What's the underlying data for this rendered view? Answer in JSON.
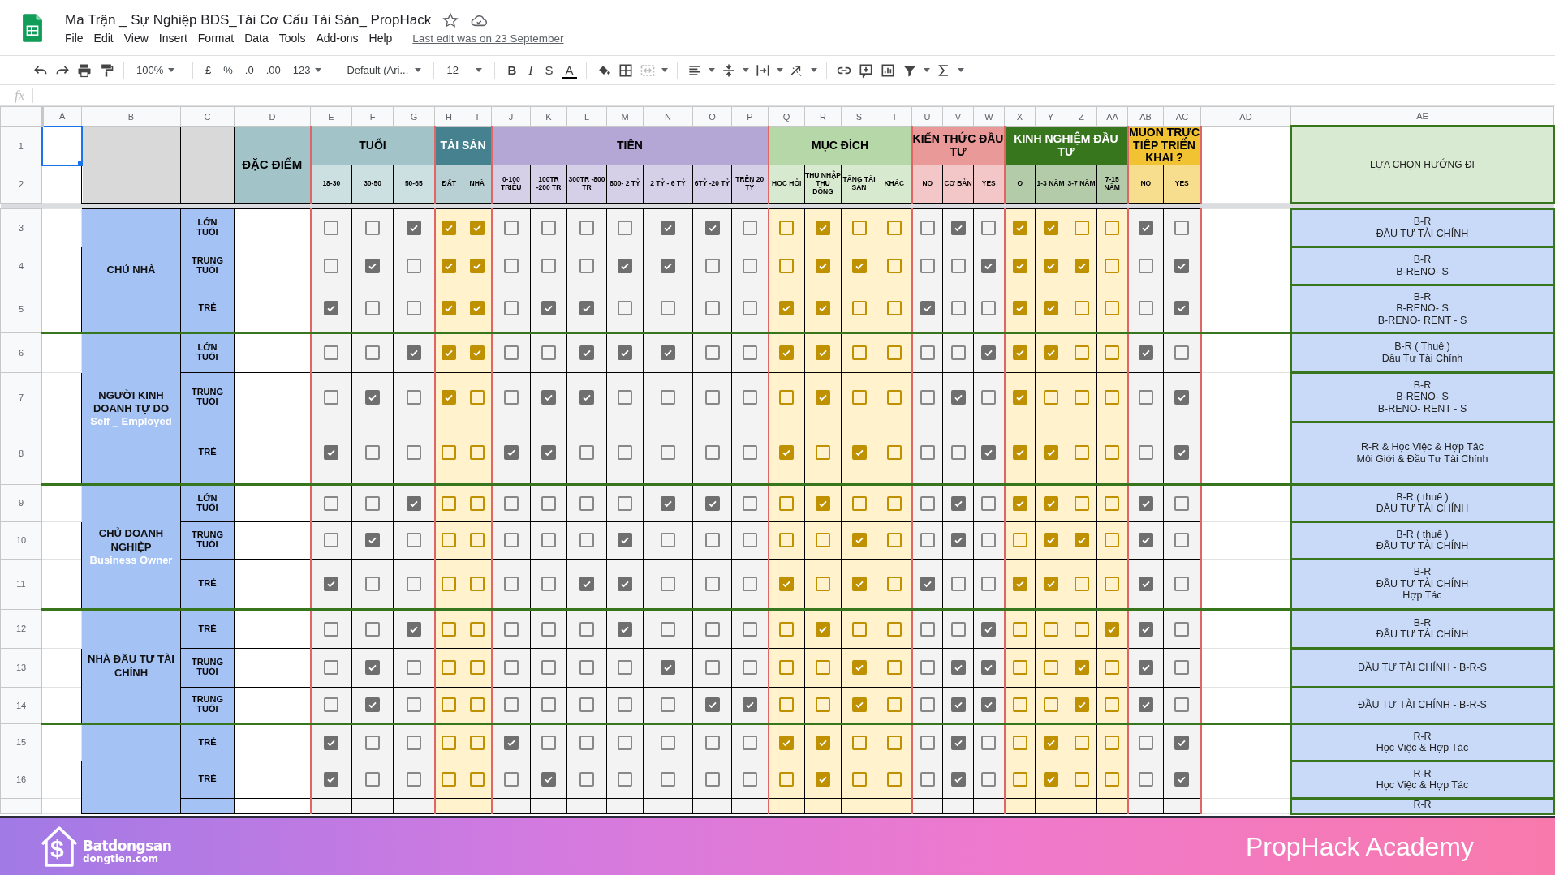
{
  "document": {
    "title": "Ma Trận _ Sự Nghiệp BDS_Tái Cơ Cấu Tài Sản_ PropHack",
    "menu": [
      "File",
      "Edit",
      "View",
      "Insert",
      "Format",
      "Data",
      "Tools",
      "Add-ons",
      "Help"
    ],
    "last_edit": "Last edit was on 23 September"
  },
  "toolbar": {
    "zoom": "100%",
    "currency": "£",
    "percent": "%",
    "decimal_less": ".0",
    "decimal_more": ".00",
    "number_format": "123",
    "font": "Default (Ari...",
    "font_size": "12",
    "bold": "B",
    "italic": "I",
    "strike": "S",
    "text_color": "A"
  },
  "formula_bar": {
    "label": "fx"
  },
  "sheet": {
    "columns": [
      "A",
      "B",
      "C",
      "D",
      "E",
      "F",
      "G",
      "H",
      "I",
      "J",
      "K",
      "L",
      "M",
      "N",
      "O",
      "P",
      "Q",
      "R",
      "S",
      "T",
      "U",
      "V",
      "W",
      "X",
      "Y",
      "Z",
      "AA",
      "AB",
      "AC",
      "AD",
      "AE"
    ],
    "header_rows": [
      {
        "number": "1",
        "selected": true
      },
      {
        "number": "2",
        "selected": false
      }
    ],
    "trait_header": "ĐẶC ĐIỂM",
    "result_header": "LỰA CHỌN HƯỚNG ĐI",
    "groups": [
      {
        "label": "TUỔI",
        "color": "#a2c4c9",
        "kind": "plain",
        "options": [
          "18-30",
          "30-50",
          "50-65"
        ]
      },
      {
        "label": "TÀI SẢN",
        "color": "#45818e",
        "kind": "gold",
        "options": [
          "ĐẤT",
          "NHÀ"
        ]
      },
      {
        "label": "TIỀN",
        "color": "#b4a7d6",
        "kind": "plain",
        "options": [
          "0-100 TRIỆU",
          "100TR -200 TR",
          "300TR -800 TR",
          "800- 2 TỶ",
          "2 TỶ - 6 TỶ",
          "6TỶ -20 TỶ",
          "TRÊN 20 TỶ"
        ]
      },
      {
        "label": "MỤC ĐÍCH",
        "color": "#b6d7a8",
        "kind": "gold",
        "options": [
          "HỌC HỎI",
          "THU NHẬP THỤ ĐỘNG",
          "TĂNG TÀI SẢN",
          "KHÁC"
        ]
      },
      {
        "label": "KIẾN THỨC ĐẦU TƯ",
        "color": "#ea9999",
        "kind": "plain",
        "options": [
          "NO",
          "CƠ BẢN",
          "YES"
        ]
      },
      {
        "label": "KINH NGHIỆM ĐẦU TƯ",
        "color": "#38761d",
        "kind": "gold",
        "options": [
          "O",
          "1-3 NĂM",
          "3-7 NĂM",
          "7-15 NĂM"
        ]
      },
      {
        "label": "MUỐN TRỰC TIẾP TRIỂN KHAI ?",
        "color": "#f1c232",
        "kind": "plain",
        "options": [
          "NO",
          "YES"
        ]
      }
    ],
    "segments": [
      {
        "label": "CHỦ NHÀ",
        "rows": [
          {
            "number": "3",
            "age": "LỚN TUỔI",
            "outcome": "B-R\nĐẦU TƯ TÀI CHÍNH",
            "checks": [
              false,
              false,
              true,
              true,
              true,
              false,
              false,
              false,
              false,
              true,
              true,
              false,
              false,
              true,
              false,
              false,
              false,
              true,
              false,
              true,
              true,
              false,
              false,
              true,
              false
            ]
          },
          {
            "number": "4",
            "age": "TRUNG TUỔI",
            "outcome": "B-R\nB-RENO- S",
            "checks": [
              false,
              true,
              false,
              true,
              true,
              false,
              false,
              false,
              true,
              true,
              false,
              false,
              false,
              true,
              true,
              false,
              false,
              false,
              true,
              true,
              true,
              true,
              false,
              false,
              true
            ]
          },
          {
            "number": "5",
            "age": "TRẺ",
            "outcome": "B-R\nB-RENO- S\nB-RENO- RENT - S",
            "checks": [
              true,
              false,
              false,
              true,
              true,
              false,
              true,
              true,
              false,
              false,
              false,
              false,
              true,
              true,
              false,
              false,
              true,
              false,
              false,
              true,
              true,
              false,
              false,
              false,
              true
            ]
          }
        ]
      },
      {
        "label": "NGƯỜI KINH DOANH TỰ DO",
        "sublabel": "Self _ Employed",
        "rows": [
          {
            "number": "6",
            "age": "LỚN TUỔI",
            "outcome": "B-R ( Thuê )\nĐầu Tư Tài Chính",
            "checks": [
              false,
              false,
              true,
              true,
              true,
              false,
              false,
              true,
              true,
              true,
              false,
              false,
              true,
              true,
              false,
              false,
              false,
              false,
              true,
              true,
              true,
              false,
              false,
              true,
              false
            ]
          },
          {
            "number": "7",
            "age": "TRUNG TUỔI",
            "outcome": "B-R\nB-RENO- S\nB-RENO- RENT - S",
            "checks": [
              false,
              true,
              false,
              true,
              false,
              false,
              true,
              true,
              false,
              false,
              false,
              false,
              false,
              true,
              false,
              false,
              false,
              true,
              false,
              true,
              false,
              false,
              false,
              false,
              true
            ]
          },
          {
            "number": "8",
            "age": "TRẺ",
            "outcome": "R-R  & Học Việc & Hợp Tác\nMôi Giới & Đầu Tư Tài Chính",
            "checks": [
              true,
              false,
              false,
              false,
              false,
              true,
              true,
              false,
              false,
              false,
              false,
              false,
              true,
              false,
              true,
              false,
              false,
              false,
              true,
              true,
              true,
              false,
              false,
              false,
              true
            ]
          }
        ]
      },
      {
        "label": "CHỦ DOANH NGHIỆP",
        "sublabel": "Business Owner",
        "rows": [
          {
            "number": "9",
            "age": "LỚN TUỔI",
            "outcome": "B-R ( thuê )\nĐẦU TƯ TÀI CHÍNH",
            "checks": [
              false,
              false,
              true,
              false,
              false,
              false,
              false,
              false,
              false,
              true,
              true,
              false,
              false,
              true,
              false,
              false,
              false,
              true,
              false,
              true,
              true,
              false,
              false,
              true,
              false
            ]
          },
          {
            "number": "10",
            "age": "TRUNG TUỔI",
            "outcome": "B-R ( thuê )\nĐẦU TƯ TÀI CHÍNH",
            "checks": [
              false,
              true,
              false,
              false,
              false,
              false,
              false,
              false,
              true,
              false,
              false,
              false,
              false,
              false,
              true,
              false,
              false,
              true,
              false,
              false,
              true,
              true,
              false,
              true,
              false
            ]
          },
          {
            "number": "11",
            "age": "TRẺ",
            "outcome": "B-R\nĐẦU TƯ TÀI CHÍNH\nHợp Tác",
            "checks": [
              true,
              false,
              false,
              false,
              false,
              false,
              false,
              true,
              true,
              false,
              false,
              false,
              true,
              false,
              true,
              false,
              true,
              false,
              false,
              true,
              true,
              false,
              false,
              true,
              false
            ]
          }
        ]
      },
      {
        "label": "NHÀ ĐẦU TƯ TÀI CHÍNH",
        "rows": [
          {
            "number": "12",
            "age": "TRẺ",
            "outcome": "B-R\nĐẦU TƯ TÀI CHÍNH",
            "checks": [
              false,
              false,
              true,
              false,
              false,
              false,
              false,
              false,
              true,
              false,
              false,
              false,
              false,
              true,
              false,
              false,
              false,
              false,
              true,
              false,
              false,
              false,
              true,
              true,
              false
            ]
          },
          {
            "number": "13",
            "age": "TRUNG TUỔI",
            "outcome": "ĐẦU TƯ TÀI CHÍNH - B-R-S",
            "checks": [
              false,
              true,
              false,
              false,
              false,
              false,
              false,
              false,
              false,
              true,
              false,
              false,
              false,
              false,
              true,
              false,
              false,
              true,
              true,
              false,
              false,
              true,
              false,
              true,
              false
            ]
          },
          {
            "number": "14",
            "age": "TRUNG TUỔI",
            "outcome": "ĐẦU TƯ TÀI CHÍNH - B-R-S",
            "checks": [
              false,
              true,
              false,
              false,
              false,
              false,
              false,
              false,
              false,
              false,
              true,
              true,
              false,
              false,
              true,
              false,
              false,
              true,
              true,
              false,
              false,
              true,
              false,
              true,
              false
            ]
          }
        ]
      },
      {
        "rows": [
          {
            "number": "15",
            "age": "TRẺ",
            "outcome": "R-R\nHọc Việc & Hợp Tác",
            "checks": [
              true,
              false,
              false,
              false,
              false,
              true,
              false,
              false,
              false,
              false,
              false,
              false,
              true,
              true,
              false,
              false,
              false,
              true,
              false,
              false,
              true,
              false,
              false,
              false,
              true
            ]
          },
          {
            "number": "16",
            "age": "TRẺ",
            "outcome": "R-R\nHọc Việc & Hợp Tác",
            "checks": [
              true,
              false,
              false,
              false,
              false,
              false,
              true,
              false,
              false,
              false,
              false,
              false,
              false,
              true,
              false,
              false,
              false,
              true,
              false,
              false,
              true,
              false,
              false,
              false,
              true
            ]
          },
          {
            "outcome": "R-R"
          }
        ]
      }
    ]
  },
  "banner": {
    "logo_symbol": "$",
    "logo_name": "Batdongsan",
    "logo_site": "dongtien.com",
    "title": "PropHack Academy"
  }
}
